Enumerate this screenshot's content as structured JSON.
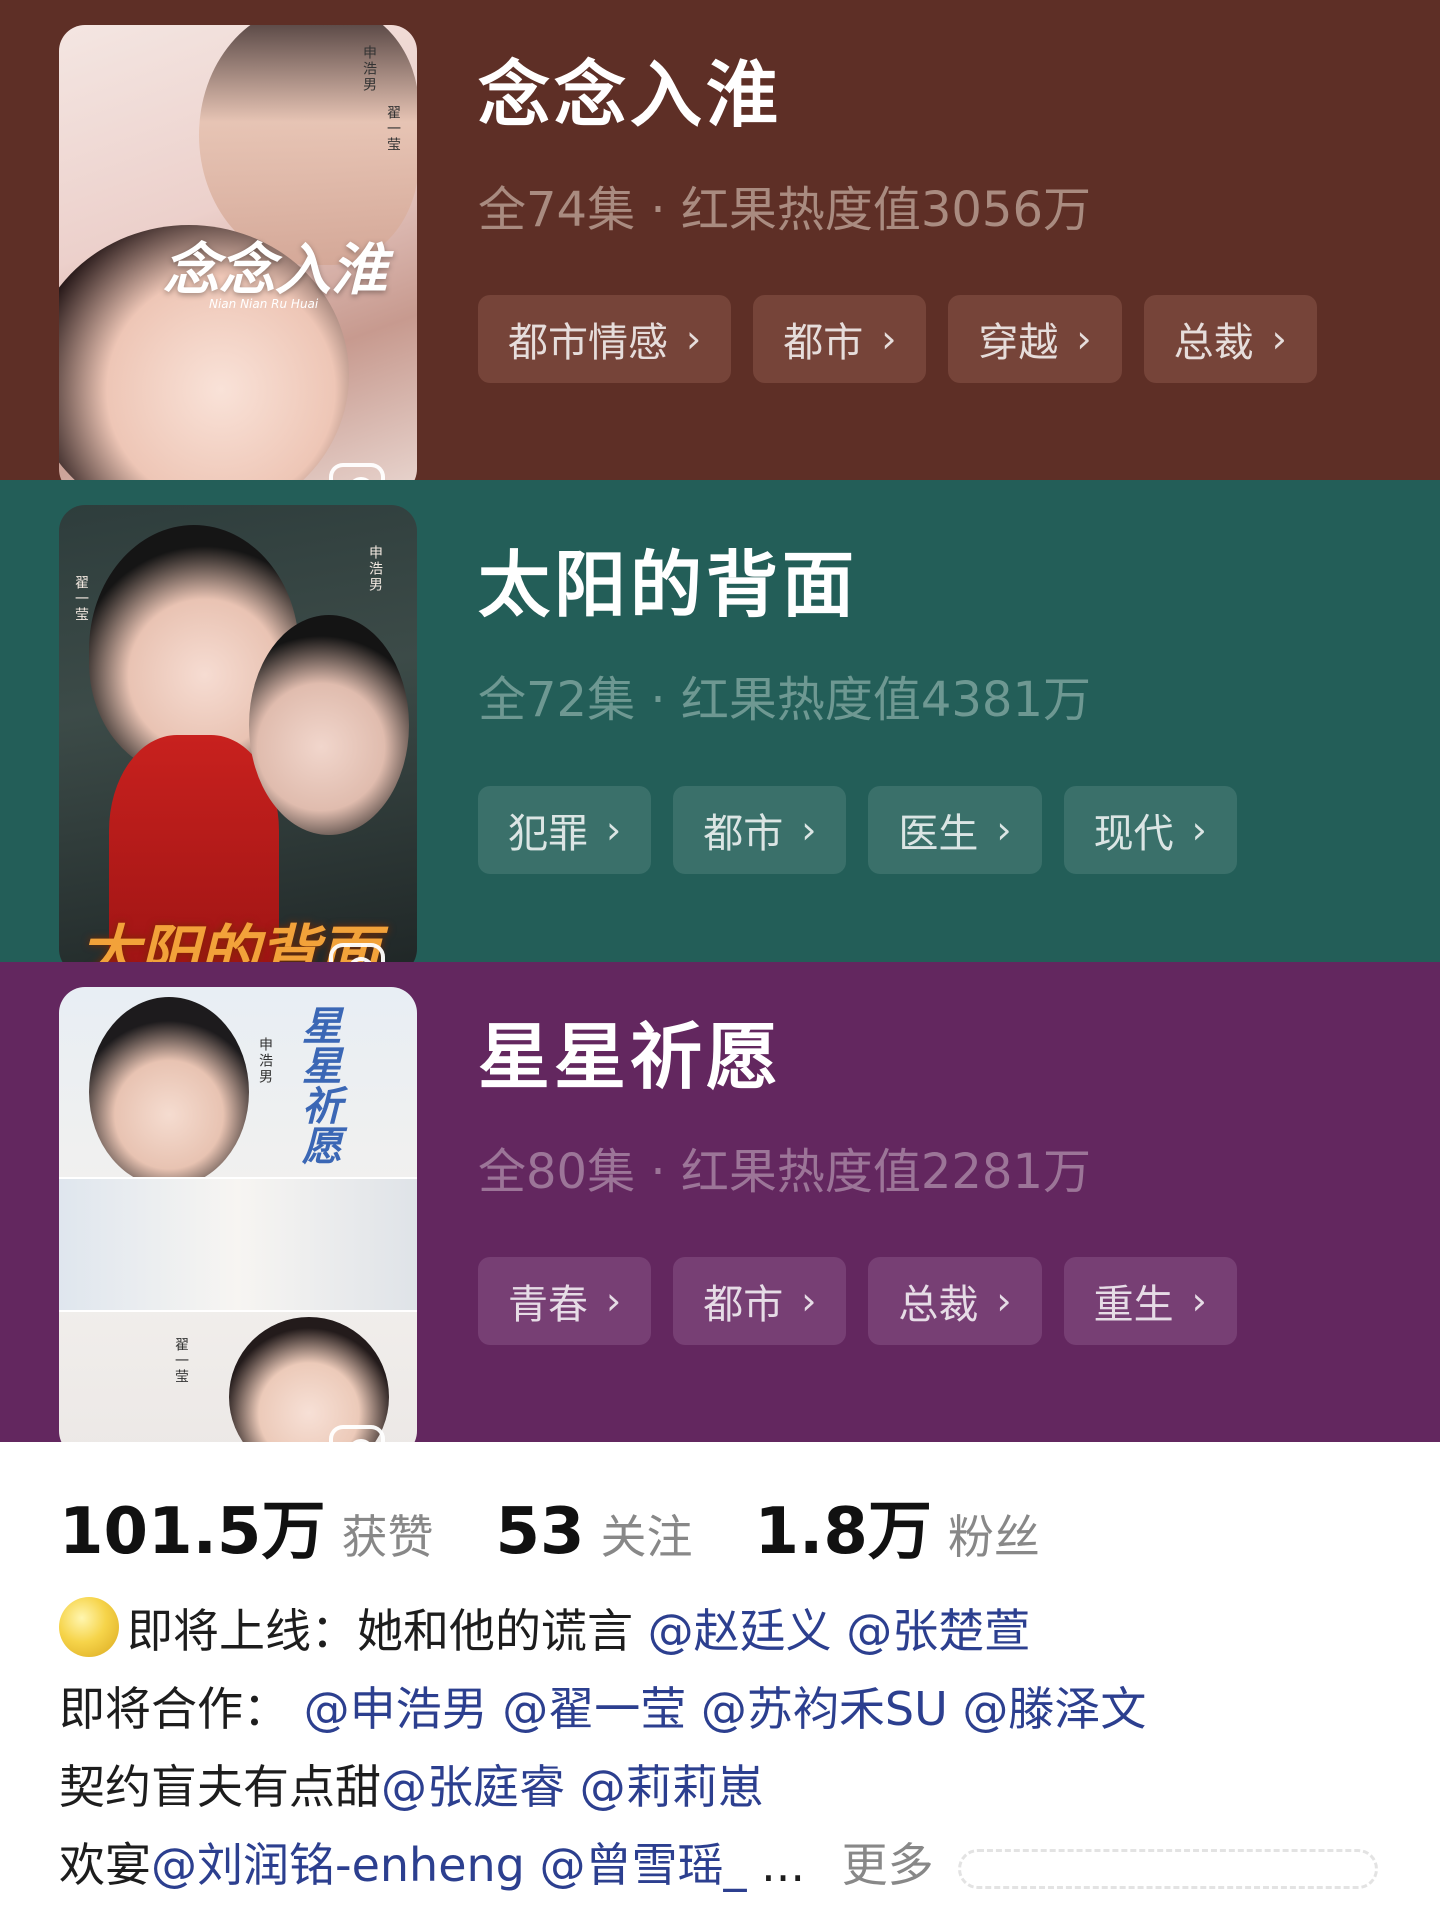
{
  "cards": [
    {
      "title": "念念入淮",
      "meta": "全74集 · 红果热度值3056万",
      "tags": [
        "都市情感",
        "都市",
        "穿越",
        "总裁"
      ],
      "poster_title": "念念入淮",
      "poster_subtitle": "Nian Nian Ru Huai",
      "poster_credits": [
        "申浩男",
        "翟一莹"
      ]
    },
    {
      "title": "太阳的背面",
      "meta": "全72集 · 红果热度值4381万",
      "tags": [
        "犯罪",
        "都市",
        "医生",
        "现代"
      ],
      "poster_title": "太阳的背面",
      "poster_credits": [
        "申浩男",
        "翟一莹"
      ]
    },
    {
      "title": "星星祈愿",
      "meta": "全80集 · 红果热度值2281万",
      "tags": [
        "青春",
        "都市",
        "总裁",
        "重生"
      ],
      "poster_title": "星星祈愿",
      "poster_credits": [
        "申浩男",
        "翟一莹"
      ]
    }
  ],
  "chevron": "›",
  "profile": {
    "stats": [
      {
        "num": "101.5万",
        "label": "获赞"
      },
      {
        "num": "53",
        "label": "关注"
      },
      {
        "num": "1.8万",
        "label": "粉丝"
      }
    ],
    "bio": {
      "line1_prefix": "即将上线：她和他的谎言",
      "line1_mentions": [
        "@赵廷义",
        "@张楚萱"
      ],
      "line2_prefix": "即将合作：",
      "line2_mentions": [
        "@申浩男",
        "@翟一莹",
        "@苏袀禾SU",
        "@滕泽文"
      ],
      "line3_prefix": "契约盲夫有点甜",
      "line3_mentions": [
        "@张庭睿",
        "@莉莉崽"
      ],
      "line4_prefix": "欢宴",
      "line4_mentions": [
        "@刘润铭-enheng",
        "@曾雪瑶_"
      ],
      "ellipsis": "...",
      "more": "更多"
    }
  }
}
